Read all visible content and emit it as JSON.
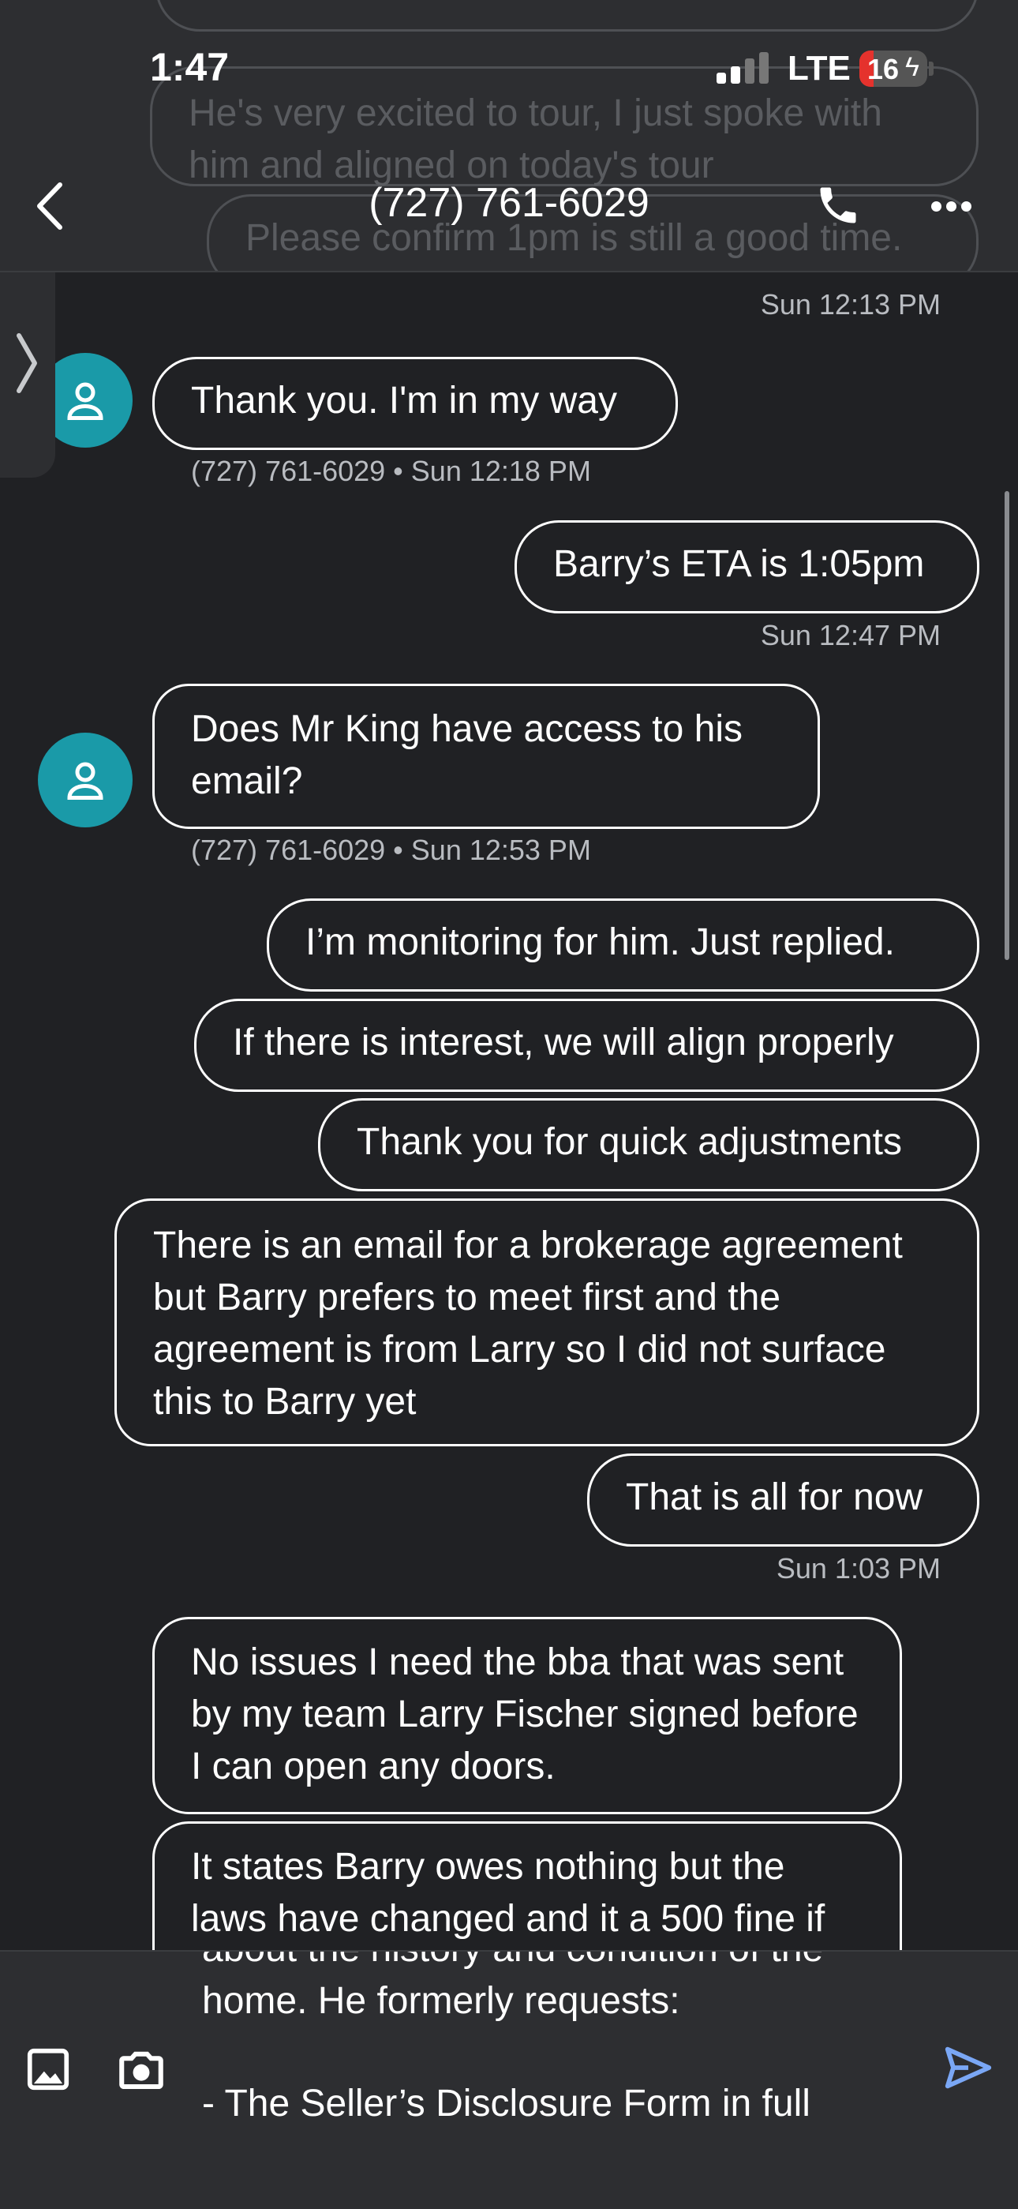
{
  "status_bar": {
    "time": "1:47",
    "network": "LTE",
    "battery": "16"
  },
  "header": {
    "title": "(727) 761-6029",
    "back_icon": "chevron-left-icon",
    "call_icon": "phone-icon",
    "more_icon": "more-horizontal-icon"
  },
  "header_ghost": [
    "He's very excited to tour, I just spoke with",
    "him and aligned on today's tour",
    "Please confirm 1pm is still a good time."
  ],
  "messages": [
    {
      "ts": "Sun 12:13 PM"
    },
    {
      "text": "Thank you. I'm in my way",
      "meta": "(727) 761-6029 • Sun 12:18 PM"
    },
    {
      "text": "Barry’s ETA is 1:05pm",
      "ts": "Sun 12:47 PM"
    },
    {
      "text": "Does Mr King have access to his email?",
      "meta": "(727) 761-6029 • Sun 12:53 PM"
    },
    {
      "text": "I’m monitoring for him. Just replied."
    },
    {
      "text": "If there is interest, we will align properly"
    },
    {
      "text": "Thank you for quick adjustments"
    },
    {
      "text": "There is an email for a brokerage agreement but Barry prefers to meet first and the agreement is from Larry so I did not surface this to Barry yet"
    },
    {
      "text": "That is all for now",
      "ts": "Sun 1:03 PM"
    },
    {
      "text": "No issues I need the bba that was sent by my team Larry Fischer signed before I can open any doors."
    },
    {
      "text": "It states Barry owes nothing but the laws have changed and it a 500 fine if"
    }
  ],
  "compose": {
    "line_cut": "about the history and condition of the",
    "line1": "home. He formerly requests:",
    "line2": "- The Seller’s Disclosure Form in full",
    "gallery_icon": "image-icon",
    "camera_icon": "camera-icon",
    "send_icon": "send-icon"
  }
}
